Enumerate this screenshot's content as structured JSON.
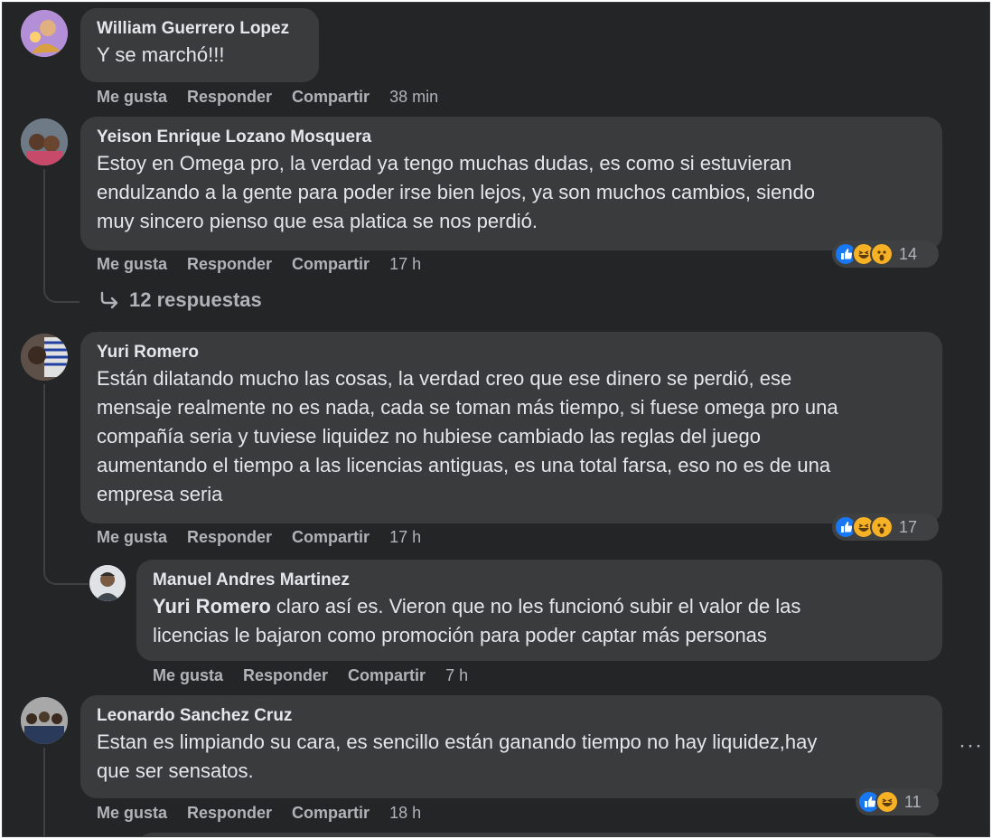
{
  "comments": [
    {
      "author": "William Guerrero Lopez",
      "text": "Y se marchó!!!",
      "actions": {
        "like": "Me gusta",
        "reply": "Responder",
        "share": "Compartir",
        "time": "38 min"
      }
    },
    {
      "author": "Yeison Enrique Lozano Mosquera",
      "lines": [
        "Estoy en Omega pro, la verdad ya tengo muchas dudas, es como si estuvieran",
        "endulzando a la gente para poder irse bien lejos, ya son muchos cambios, siendo",
        "muy sincero pienso que esa platica se nos perdió."
      ],
      "reactions": {
        "icons": [
          "like-icon",
          "haha-icon",
          "wow-icon"
        ],
        "count": "14"
      },
      "actions": {
        "like": "Me gusta",
        "reply": "Responder",
        "share": "Compartir",
        "time": "17 h"
      },
      "replies_label": "12 respuestas"
    },
    {
      "author": "Yuri Romero",
      "lines": [
        "Están dilatando mucho las cosas, la verdad creo que ese dinero se perdió, ese",
        "mensaje realmente no es nada, cada se toman más tiempo, si fuese omega pro una",
        "compañía seria y tuviese liquidez no hubiese cambiado las reglas del juego",
        "aumentando el tiempo a las licencias antiguas, es una total farsa, eso no es de una",
        "empresa seria"
      ],
      "reactions": {
        "icons": [
          "like-icon",
          "haha-icon",
          "wow-icon"
        ],
        "count": "17"
      },
      "actions": {
        "like": "Me gusta",
        "reply": "Responder",
        "share": "Compartir",
        "time": "17 h"
      }
    },
    {
      "author": "Manuel Andres Martinez",
      "mention": "Yuri Romero",
      "line1_rest": " claro así es. Vieron que no les funcionó subir el valor de las",
      "line2": "licencias le bajaron como promoción para poder captar más personas",
      "actions": {
        "like": "Me gusta",
        "reply": "Responder",
        "share": "Compartir",
        "time": "7 h"
      }
    },
    {
      "author": "Leonardo Sanchez Cruz",
      "lines": [
        "Estan es limpiando su cara, es sencillo están ganando tiempo no hay liquidez,hay",
        "que ser sensatos."
      ],
      "reactions": {
        "icons": [
          "like-icon",
          "haha-icon"
        ],
        "count": "11"
      },
      "actions": {
        "like": "Me gusta",
        "reply": "Responder",
        "share": "Compartir",
        "time": "18 h"
      },
      "more_label": "···"
    }
  ],
  "colors": {
    "background": "#242526",
    "bubble": "#3a3b3c",
    "text": "#e4e6eb",
    "muted": "#b0b3b8",
    "like": "#1877f2",
    "emoji": "#f7b125"
  }
}
